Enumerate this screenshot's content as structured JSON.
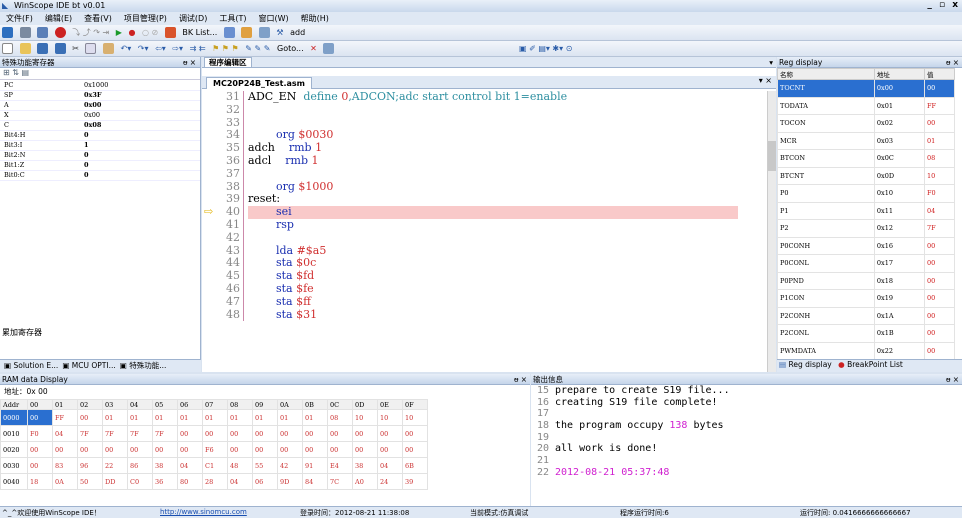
{
  "app": {
    "title": "WinScope IDE bt v0.01",
    "win_controls": "_ ▫ x"
  },
  "menu": [
    "文件(F)",
    "编辑(E)",
    "查看(V)",
    "项目管理(P)",
    "调试(D)",
    "工具(T)",
    "窗口(W)",
    "帮助(H)"
  ],
  "toolbar": {
    "bk_list": "BK List...",
    "add": "add",
    "goto": "Goto..."
  },
  "left_panel": {
    "title": "特殊功能寄存器",
    "pin": "ᵿ ×",
    "registers": [
      {
        "name": "PC",
        "value": "0x1000",
        "bold": false
      },
      {
        "name": "SP",
        "value": "0x3F",
        "bold": true
      },
      {
        "name": "A",
        "value": "0x00",
        "bold": true
      },
      {
        "name": "X",
        "value": "0x00",
        "bold": false
      },
      {
        "name": "C",
        "value": "0x08",
        "bold": true
      },
      {
        "name": "Bit4:H",
        "value": "0",
        "bold": true
      },
      {
        "name": "Bit3:I",
        "value": "1",
        "bold": true
      },
      {
        "name": "Bit2:N",
        "value": "0",
        "bold": true
      },
      {
        "name": "Bit1:Z",
        "value": "0",
        "bold": true
      },
      {
        "name": "Bit0:C",
        "value": "0",
        "bold": true
      }
    ],
    "bottom_label": "累加寄存器",
    "tabs": [
      "Solution E...",
      "MCU OPTI...",
      "特殊功能..."
    ]
  },
  "editor": {
    "panel_title": "程序编辑区",
    "file_tab": "MC20P24B_Test.asm",
    "lines": [
      {
        "n": "31",
        "html": "<span>ADC_EN  </span><span class='def'>define </span><span class='num'>0</span><span class='def'>,ADCON;adc start control bit 1=enable</span>"
      },
      {
        "n": "32",
        "html": ""
      },
      {
        "n": "33",
        "html": ""
      },
      {
        "n": "34",
        "html": "<span class='kw'>        org </span><span class='num'>$0030</span>"
      },
      {
        "n": "35",
        "html": "<span>adch    </span><span class='kw'>rmb </span><span class='num'>1</span>"
      },
      {
        "n": "36",
        "html": "<span>adcl    </span><span class='kw'>rmb </span><span class='num'>1</span>"
      },
      {
        "n": "37",
        "html": ""
      },
      {
        "n": "38",
        "html": "<span class='kw'>        org </span><span class='num'>$1000</span>"
      },
      {
        "n": "39",
        "html": "<span>reset:</span>"
      },
      {
        "n": "40",
        "html": "<span class='kw'>        sei</span>",
        "hl": true
      },
      {
        "n": "41",
        "html": "<span class='kw'>        rsp</span>"
      },
      {
        "n": "42",
        "html": ""
      },
      {
        "n": "43",
        "html": "<span class='kw'>        lda </span><span class='num'>#$a5</span>"
      },
      {
        "n": "44",
        "html": "<span class='kw'>        sta </span><span class='num'>$0c</span>"
      },
      {
        "n": "45",
        "html": "<span class='kw'>        sta </span><span class='num'>$fd</span>"
      },
      {
        "n": "46",
        "html": "<span class='kw'>        sta </span><span class='num'>$fe</span>"
      },
      {
        "n": "47",
        "html": "<span class='kw'>        sta </span><span class='num'>$ff</span>"
      },
      {
        "n": "48",
        "html": "<span class='kw'>        sta </span><span class='num'>$31</span>"
      }
    ]
  },
  "reg_display": {
    "title": "Reg display",
    "cols": [
      "名称",
      "地址",
      "值"
    ],
    "rows": [
      [
        "TOCNT",
        "0x00",
        "00"
      ],
      [
        "TODATA",
        "0x01",
        "FF"
      ],
      [
        "TOCON",
        "0x02",
        "00"
      ],
      [
        "MCR",
        "0x03",
        "01"
      ],
      [
        "BTCON",
        "0x0C",
        "08"
      ],
      [
        "BTCNT",
        "0x0D",
        "10"
      ],
      [
        "P0",
        "0x10",
        "F0"
      ],
      [
        "P1",
        "0x11",
        "04"
      ],
      [
        "P2",
        "0x12",
        "7F"
      ],
      [
        "P0CONH",
        "0x16",
        "00"
      ],
      [
        "P0CONL",
        "0x17",
        "00"
      ],
      [
        "P0PND",
        "0x18",
        "00"
      ],
      [
        "P1CON",
        "0x19",
        "00"
      ],
      [
        "P2CONH",
        "0x1A",
        "00"
      ],
      [
        "P2CONL",
        "0x1B",
        "00"
      ],
      [
        "PWMDATA",
        "0x22",
        "00"
      ]
    ],
    "tabs": [
      "Reg display",
      "BreakPoint List"
    ]
  },
  "ram": {
    "title": "RAM data Display",
    "address_label": "地址：0x 00",
    "header": [
      "Addr",
      "00",
      "01",
      "02",
      "03",
      "04",
      "05",
      "06",
      "07",
      "08",
      "09",
      "0A",
      "0B",
      "0C",
      "0D",
      "0E",
      "0F"
    ],
    "rows": [
      [
        "0000",
        "00",
        "FF",
        "00",
        "01",
        "01",
        "01",
        "01",
        "01",
        "01",
        "01",
        "01",
        "01",
        "08",
        "10",
        "10",
        "10"
      ],
      [
        "0010",
        "F0",
        "04",
        "7F",
        "7F",
        "7F",
        "7F",
        "00",
        "00",
        "00",
        "00",
        "00",
        "00",
        "00",
        "00",
        "00",
        "00"
      ],
      [
        "0020",
        "00",
        "00",
        "00",
        "00",
        "00",
        "00",
        "00",
        "F6",
        "00",
        "00",
        "00",
        "00",
        "00",
        "00",
        "00",
        "00"
      ],
      [
        "0030",
        "00",
        "83",
        "96",
        "22",
        "86",
        "38",
        "04",
        "C1",
        "48",
        "55",
        "42",
        "91",
        "E4",
        "38",
        "04",
        "6B"
      ],
      [
        "0040",
        "18",
        "0A",
        "50",
        "DD",
        "C0",
        "36",
        "80",
        "28",
        "04",
        "06",
        "9D",
        "84",
        "7C",
        "A0",
        "24",
        "39"
      ]
    ]
  },
  "output": {
    "title": "输出信息",
    "lines": [
      {
        "n": "15",
        "t": "prepare to create S19 file..."
      },
      {
        "n": "16",
        "t": "creating S19 file complete!"
      },
      {
        "n": "17",
        "t": ""
      },
      {
        "n": "18",
        "t": "the program occupy ",
        "num": "138",
        "t2": " bytes"
      },
      {
        "n": "19",
        "t": ""
      },
      {
        "n": "20",
        "t": "all work is done!"
      },
      {
        "n": "21",
        "t": ""
      },
      {
        "n": "22",
        "t": "",
        "date": "2012-08-21 05:37:48"
      }
    ]
  },
  "status": {
    "welcome": "^_^欢迎使用WinScope IDE！",
    "url": "http://www.sinomcu.com",
    "login": "登录时间：2012-08-21 11:38:08",
    "mode": "当前模式:仿真调试",
    "runtime": "程序运行时间:6",
    "runtime2": "运行时间: 0.0416666666666667"
  }
}
